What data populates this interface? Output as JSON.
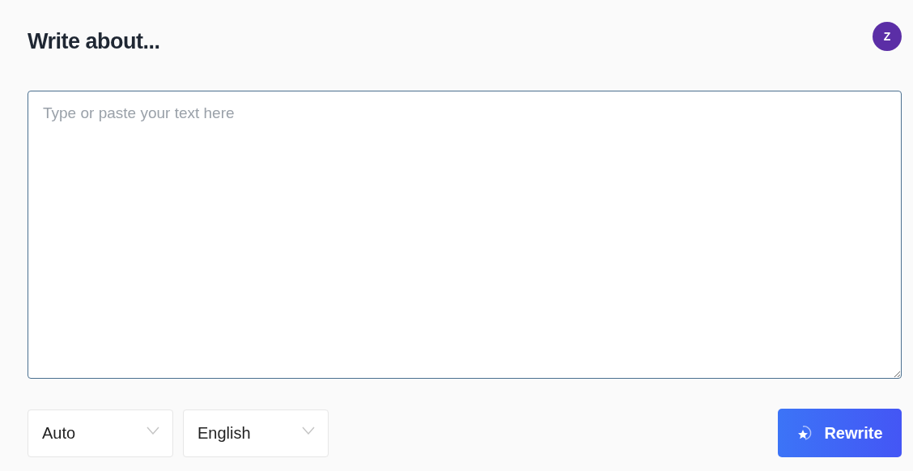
{
  "header": {
    "title": "Write about...",
    "avatar": "Z"
  },
  "editor": {
    "placeholder": "Type or paste your text here"
  },
  "selects": [
    {
      "value": "Auto"
    },
    {
      "value": "English"
    }
  ],
  "action_button": {
    "label": "Rewrite"
  }
}
